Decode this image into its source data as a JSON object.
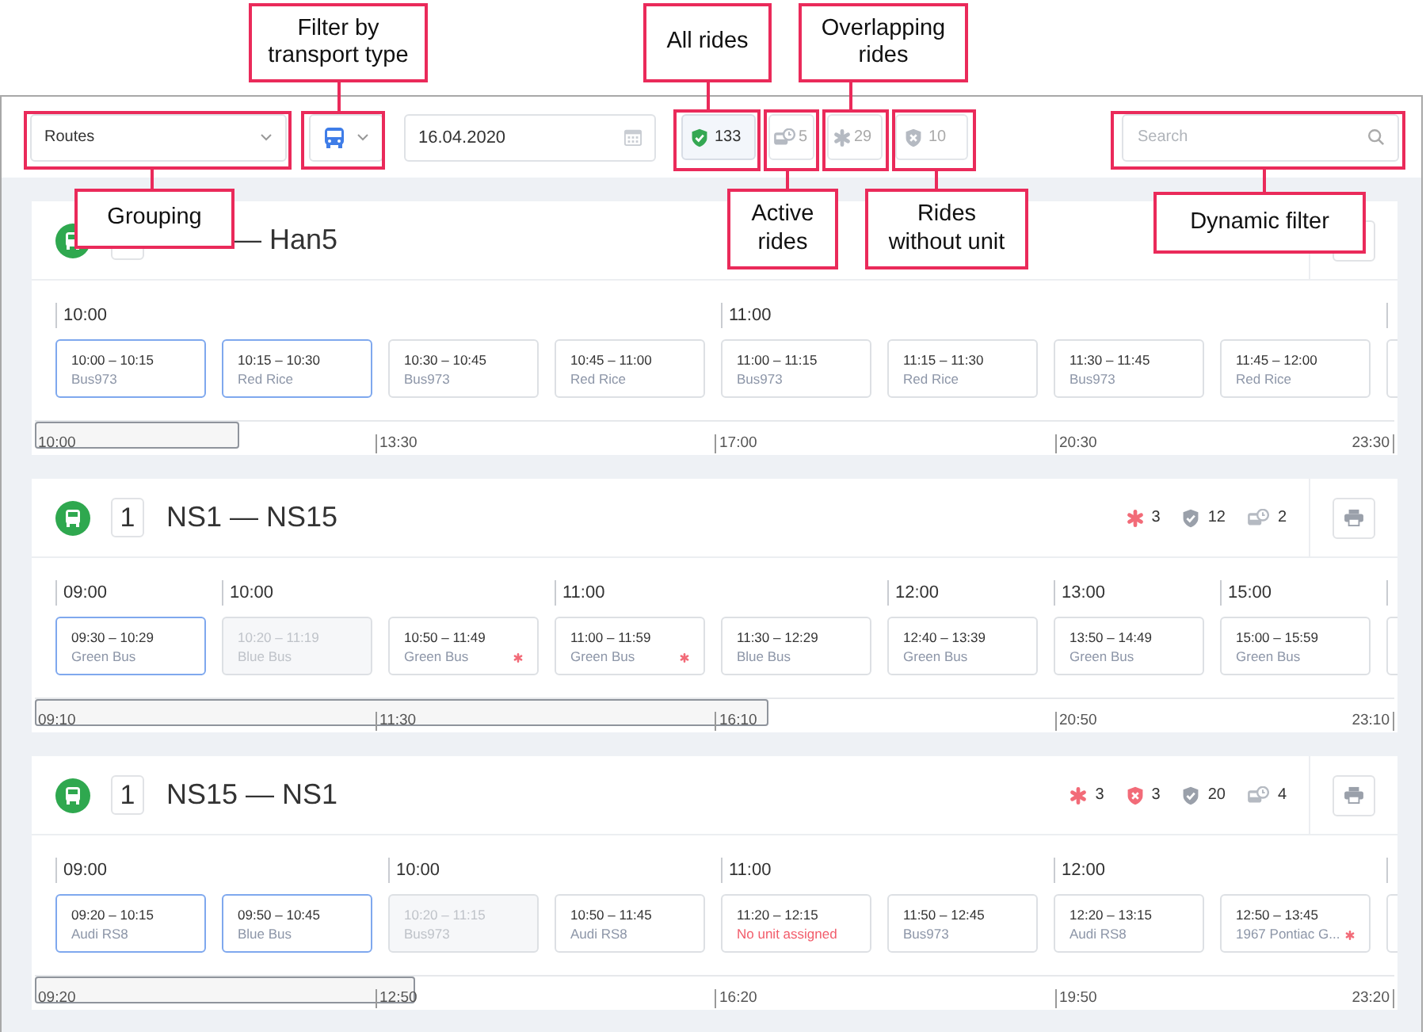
{
  "toolbar": {
    "grouping": {
      "value": "Routes"
    },
    "transport_filter": {
      "kind": "bus"
    },
    "date": {
      "value": "16.04.2020"
    },
    "counters": [
      {
        "kind": "all",
        "count": "133",
        "selected": true
      },
      {
        "kind": "active",
        "count": "5",
        "selected": false
      },
      {
        "kind": "overlap",
        "count": "29",
        "selected": false
      },
      {
        "kind": "no_unit",
        "count": "10",
        "selected": false
      }
    ],
    "search": {
      "placeholder": "Search"
    }
  },
  "routes": [
    {
      "title": "— Han5",
      "rides": [
        {
          "hour": "10:00",
          "time": "10:00 – 10:15",
          "unit": "Bus973",
          "kind": "selected",
          "overlap": false
        },
        {
          "time": "10:15 – 10:30",
          "unit": "Red Rice",
          "kind": "selected",
          "overlap": false
        },
        {
          "time": "10:30 – 10:45",
          "unit": "Bus973",
          "kind": "normal",
          "overlap": false
        },
        {
          "time": "10:45 – 11:00",
          "unit": "Red Rice",
          "kind": "normal",
          "overlap": false
        },
        {
          "hour": "11:00",
          "time": "11:00 – 11:15",
          "unit": "Bus973",
          "kind": "normal",
          "overlap": false
        },
        {
          "time": "11:15 – 11:30",
          "unit": "Red Rice",
          "kind": "normal",
          "overlap": false
        },
        {
          "time": "11:30 – 11:45",
          "unit": "Bus973",
          "kind": "normal",
          "overlap": false
        },
        {
          "time": "11:45 – 12:00",
          "unit": "Red Rice",
          "kind": "normal",
          "overlap": false
        }
      ],
      "range": {
        "level": 0.15,
        "ticks": [
          "10:00",
          "13:30",
          "17:00",
          "20:30",
          "23:30"
        ]
      }
    },
    {
      "number": "1",
      "title": "NS1 — NS15",
      "stats": [
        {
          "kind": "overlap",
          "count": "3"
        },
        {
          "kind": "all",
          "count": "12"
        },
        {
          "kind": "active",
          "count": "2"
        }
      ],
      "rides": [
        {
          "hour": "09:00",
          "time": "09:30 – 10:29",
          "unit": "Green Bus",
          "kind": "selected",
          "overlap": false
        },
        {
          "hour": "10:00",
          "time": "10:20 – 11:19",
          "unit": "Blue Bus",
          "kind": "past",
          "overlap": false
        },
        {
          "time": "10:50 – 11:49",
          "unit": "Green Bus",
          "kind": "normal",
          "overlap": true
        },
        {
          "hour": "11:00",
          "time": "11:00 – 11:59",
          "unit": "Green Bus",
          "kind": "normal",
          "overlap": true
        },
        {
          "time": "11:30 – 12:29",
          "unit": "Blue Bus",
          "kind": "normal",
          "overlap": false
        },
        {
          "hour": "12:00",
          "time": "12:40 – 13:39",
          "unit": "Green Bus",
          "kind": "normal",
          "overlap": false
        },
        {
          "hour": "13:00",
          "time": "13:50 – 14:49",
          "unit": "Green Bus",
          "kind": "normal",
          "overlap": false
        },
        {
          "hour": "15:00",
          "time": "15:00 – 15:59",
          "unit": "Green Bus",
          "kind": "normal",
          "overlap": false
        }
      ],
      "range": {
        "level": 0.54,
        "ticks": [
          "09:10",
          "11:30",
          "16:10",
          "20:50",
          "23:10"
        ]
      }
    },
    {
      "number": "1",
      "title": "NS15 — NS1",
      "stats": [
        {
          "kind": "overlap",
          "count": "3"
        },
        {
          "kind": "no_unit",
          "count": "3"
        },
        {
          "kind": "all",
          "count": "20"
        },
        {
          "kind": "active",
          "count": "4"
        }
      ],
      "rides": [
        {
          "hour": "09:00",
          "time": "09:20 – 10:15",
          "unit": "Audi RS8",
          "kind": "selected",
          "overlap": false
        },
        {
          "time": "09:50 – 10:45",
          "unit": "Blue Bus",
          "kind": "selected",
          "overlap": false
        },
        {
          "hour": "10:00",
          "time": "10:20 – 11:15",
          "unit": "Bus973",
          "kind": "past",
          "overlap": false
        },
        {
          "time": "10:50 – 11:45",
          "unit": "Audi RS8",
          "kind": "normal",
          "overlap": false
        },
        {
          "hour": "11:00",
          "time": "11:20 – 12:15",
          "unit": "No unit assigned",
          "kind": "unassigned",
          "overlap": false
        },
        {
          "time": "11:50 – 12:45",
          "unit": "Bus973",
          "kind": "normal",
          "overlap": false
        },
        {
          "hour": "12:00",
          "time": "12:20 – 13:15",
          "unit": "Audi RS8",
          "kind": "normal",
          "overlap": false
        },
        {
          "time": "12:50 – 13:45",
          "unit": "1967 Pontiac G...",
          "kind": "normal",
          "overlap": true
        }
      ],
      "range": {
        "level": 0.28,
        "ticks": [
          "09:20",
          "12:50",
          "16:20",
          "19:50",
          "23:20"
        ]
      }
    }
  ],
  "annotations": [
    {
      "text": "Filter by transport type"
    },
    {
      "text": "All rides"
    },
    {
      "text": "Overlapping rides"
    },
    {
      "text": "Grouping"
    },
    {
      "text": "Active rides"
    },
    {
      "text": "Rides without unit"
    },
    {
      "text": "Dynamic filter"
    }
  ]
}
